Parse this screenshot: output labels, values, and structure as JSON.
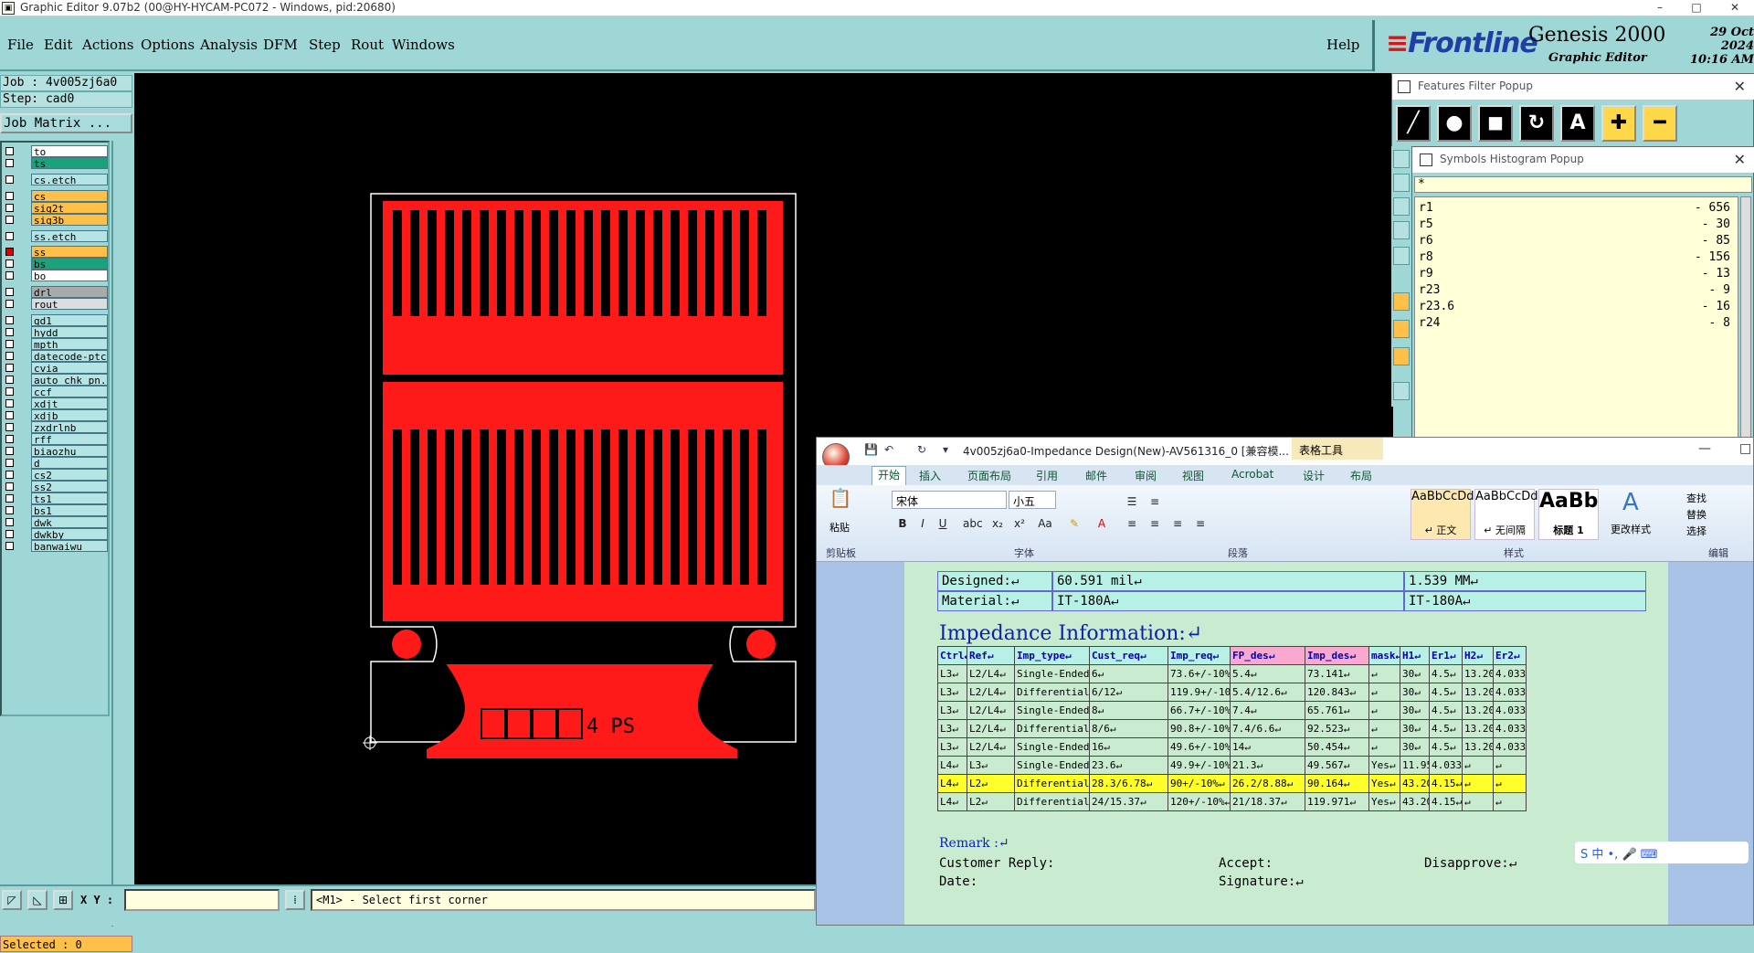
{
  "window": {
    "title": "Graphic Editor 9.07b2 (00@HY-HYCAM-PC072 - Windows, pid:20680)"
  },
  "menu": {
    "items": [
      "File",
      "Edit",
      "Actions",
      "Options",
      "Analysis",
      "DFM",
      "Step",
      "Rout",
      "Windows"
    ],
    "help": "Help"
  },
  "brand": {
    "logo": "Frontline",
    "product": "Genesis 2000",
    "subtitle": "Graphic Editor",
    "date": "29 Oct 2024",
    "time": "10:16 AM"
  },
  "job": {
    "job_line": "Job : 4v005zj6a0",
    "step_line": "Step: cad0",
    "matrix_button": "Job Matrix ..."
  },
  "layers": [
    {
      "name": "to",
      "color": "#ffffff"
    },
    {
      "name": "ts",
      "color": "#1aa37a"
    },
    {
      "name": "cs.etch",
      "color": "#b4e4e4"
    },
    {
      "name": "cs",
      "color": "#ffc04a"
    },
    {
      "name": "sig2t",
      "color": "#ffc04a"
    },
    {
      "name": "sig3b",
      "color": "#ffc04a"
    },
    {
      "name": "ss.etch",
      "color": "#b4e4e4"
    },
    {
      "name": "ss",
      "color": "#ffc04a"
    },
    {
      "name": "bs",
      "color": "#1aa37a"
    },
    {
      "name": "bo",
      "color": "#ffffff"
    },
    {
      "name": "drl",
      "color": "#aaaaaa"
    },
    {
      "name": "rout",
      "color": "#dddddd"
    },
    {
      "name": "gd1",
      "color": "#b4e4e4"
    },
    {
      "name": "hydd",
      "color": "#b4e4e4"
    },
    {
      "name": "mpth",
      "color": "#b4e4e4"
    },
    {
      "name": "datecode-ptc",
      "color": "#b4e4e4"
    },
    {
      "name": "cvia",
      "color": "#b4e4e4"
    },
    {
      "name": "auto_chk_pn.",
      "color": "#b4e4e4"
    },
    {
      "name": "ccf",
      "color": "#b4e4e4"
    },
    {
      "name": "xdjt",
      "color": "#b4e4e4"
    },
    {
      "name": "xdjb",
      "color": "#b4e4e4"
    },
    {
      "name": "zxdrlnb",
      "color": "#b4e4e4"
    },
    {
      "name": "rff",
      "color": "#b4e4e4"
    },
    {
      "name": "biaozhu",
      "color": "#b4e4e4"
    },
    {
      "name": "d",
      "color": "#b4e4e4"
    },
    {
      "name": "cs2",
      "color": "#b4e4e4"
    },
    {
      "name": "ss2",
      "color": "#b4e4e4"
    },
    {
      "name": "ts1",
      "color": "#b4e4e4"
    },
    {
      "name": "bs1",
      "color": "#b4e4e4"
    },
    {
      "name": "dwk",
      "color": "#b4e4e4"
    },
    {
      "name": "dwkby",
      "color": "#b4e4e4"
    },
    {
      "name": "banwaiwu",
      "color": "#b4e4e4"
    }
  ],
  "status": {
    "selected": "Selected : 0",
    "xy_label": "X Y :",
    "xy_value": "",
    "message": "<M1> - Select first corner"
  },
  "features_popup": {
    "title": "Features Filter Popup"
  },
  "symbols_popup": {
    "title": "Symbols Histogram Popup",
    "filter": "*",
    "rows": [
      {
        "name": "r1",
        "count": "- 656"
      },
      {
        "name": "r5",
        "count": "- 30"
      },
      {
        "name": "r6",
        "count": "- 85"
      },
      {
        "name": "r8",
        "count": "- 156"
      },
      {
        "name": "r9",
        "count": "- 13"
      },
      {
        "name": "r23",
        "count": "- 9"
      },
      {
        "name": "r23.6",
        "count": "- 16"
      },
      {
        "name": "r24",
        "count": "- 8"
      }
    ]
  },
  "word": {
    "title": "4v005zj6a0-Impedance Design(New)-AV561316_0 [兼容模...",
    "table_tools": "表格工具",
    "tabs": [
      "开始",
      "插入",
      "页面布局",
      "引用",
      "邮件",
      "审阅",
      "视图",
      "Acrobat",
      "设计",
      "布局"
    ],
    "font_name": "宋体",
    "font_size": "小五",
    "groups": [
      "剪贴板",
      "字体",
      "段落",
      "样式",
      "编辑"
    ],
    "styles": [
      {
        "preview": "AaBbCcDd",
        "label": "↵ 正文"
      },
      {
        "preview": "AaBbCcDd",
        "label": "↵ 无间隔"
      },
      {
        "preview": "AaBb",
        "label": "标题 1"
      }
    ],
    "change_styles": "更改样式",
    "edit_items": [
      "查找",
      "替换",
      "选择"
    ],
    "paste": "粘贴",
    "designed": {
      "label": "Designed:↵",
      "value1": "60.591 mil↵",
      "value2": "1.539 MM↵"
    },
    "material": {
      "label": "Material:↵",
      "value1": "IT-180A↵",
      "value2": "IT-180A↵"
    },
    "impedance_heading": "Impedance Information:↵",
    "table_headers": [
      "Ctrl↵",
      "Ref↵",
      "Imp_type↵",
      "Cust_req↵",
      "Imp_req↵",
      "FP_des↵",
      "Imp_des↵",
      "mask↵",
      "H1↵",
      "Er1↵",
      "H2↵",
      "Er2↵"
    ],
    "table_rows": [
      [
        "L3↵",
        "L2/L4↵",
        "Single-Ended↵",
        "6↵",
        "73.6+/-10%↵",
        "5.4↵",
        "73.141↵",
        "↵",
        "30↵",
        "4.5↵",
        "13.202",
        "4.033↵"
      ],
      [
        "L3↵",
        "L2/L4↵",
        "Differential↵",
        "6/12↵",
        "119.9+/-10%↵",
        "5.4/12.6↵",
        "120.843↵",
        "↵",
        "30↵",
        "4.5↵",
        "13.202",
        "4.033↵"
      ],
      [
        "L3↵",
        "L2/L4↵",
        "Single-Ended↵",
        "8↵",
        "66.7+/-10%↵",
        "7.4↵",
        "65.761↵",
        "↵",
        "30↵",
        "4.5↵",
        "13.202",
        "4.033↵"
      ],
      [
        "L3↵",
        "L2/L4↵",
        "Differential↵",
        "8/6↵",
        "90.8+/-10%↵",
        "7.4/6.6↵",
        "92.523↵",
        "↵",
        "30↵",
        "4.5↵",
        "13.202",
        "4.033↵"
      ],
      [
        "L3↵",
        "L2/L4↵",
        "Single-Ended↵",
        "16↵",
        "49.6+/-10%↵",
        "14↵",
        "50.454↵",
        "↵",
        "30↵",
        "4.5↵",
        "13.202",
        "4.033↵"
      ],
      [
        "L4↵",
        "L3↵",
        "Single-Ended↵",
        "23.6↵",
        "49.9+/-10%↵",
        "21.3↵",
        "49.567↵",
        "Yes↵",
        "11.952",
        "4.033↵",
        "↵",
        "↵"
      ],
      [
        "L4↵",
        "L2↵",
        "Differential↵",
        "28.3/6.78↵",
        "90+/-10%↵",
        "26.2/8.88↵",
        "90.164↵",
        "Yes↵",
        "43.202",
        "4.15↵",
        "↵",
        "↵"
      ],
      [
        "L4↵",
        "L2↵",
        "Differential↵",
        "24/15.37↵",
        "120+/-10%↵",
        "21/18.37↵",
        "119.971↵",
        "Yes↵",
        "43.202",
        "4.15↵",
        "↵",
        "↵"
      ]
    ],
    "remark": "Remark :↵",
    "customer_reply": "Customer Reply:",
    "accept": "Accept:",
    "disapprove": "Disapprove:↵",
    "date": "Date:",
    "signature": "Signature:↵",
    "ime": "S 中 •, 🎤 ⌨"
  },
  "pcb": {
    "label_text": "4 PS"
  }
}
